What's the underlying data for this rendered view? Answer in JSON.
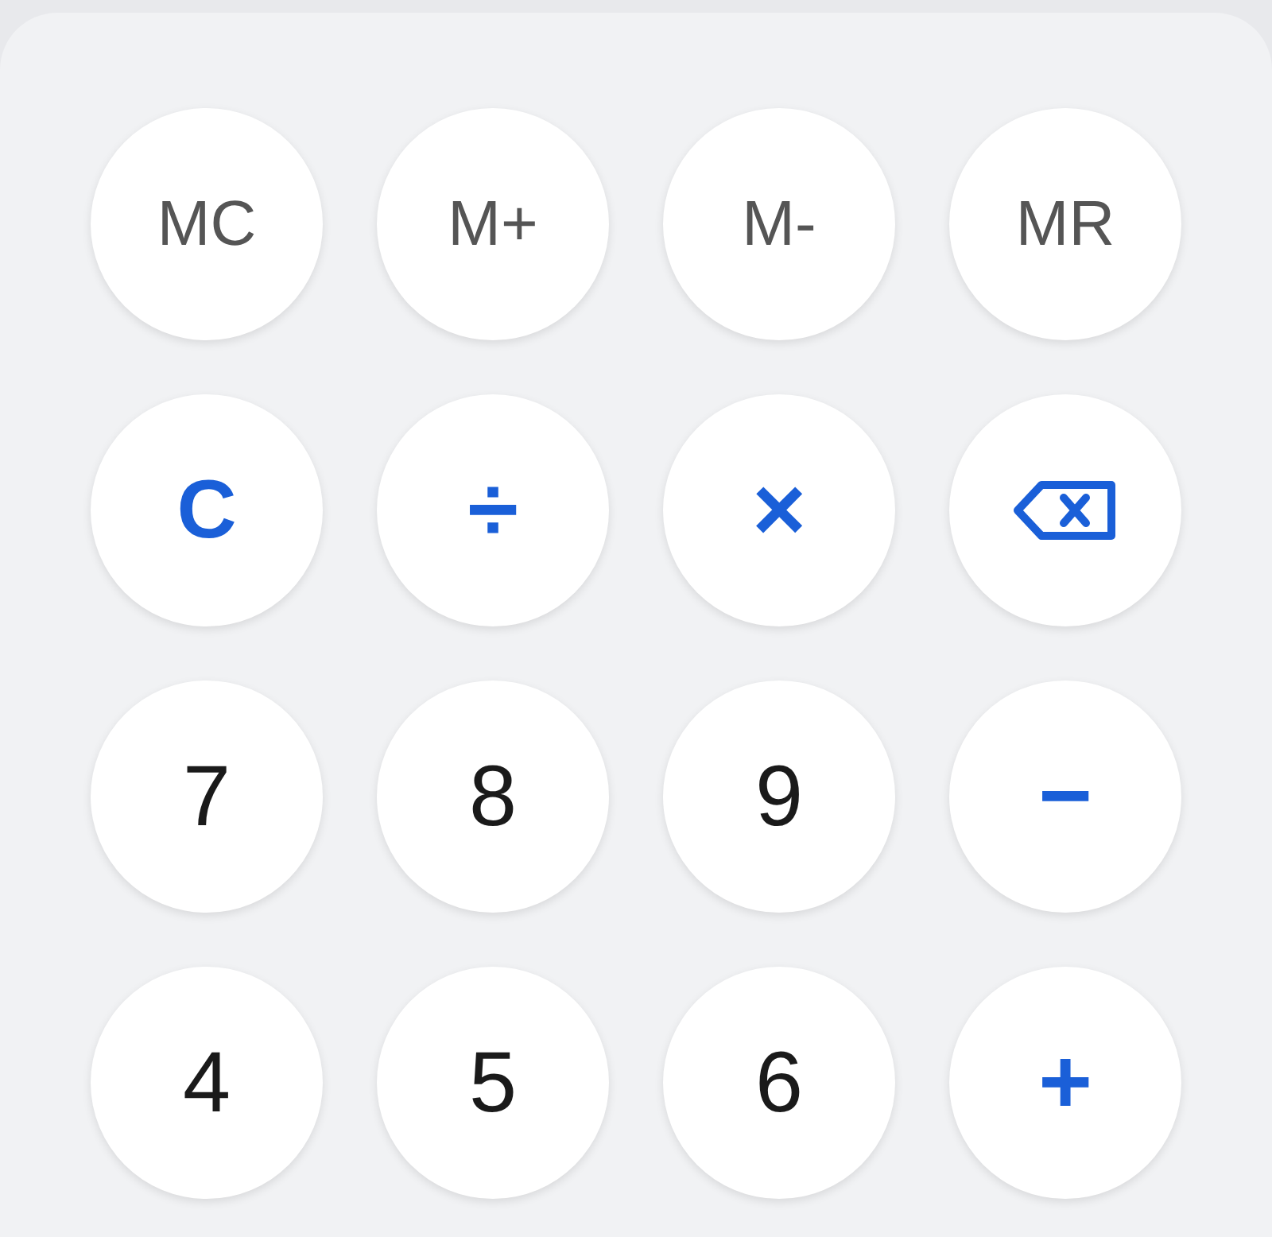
{
  "keys": [
    {
      "kind": "memory",
      "label": "MC"
    },
    {
      "kind": "memory",
      "label": "M+"
    },
    {
      "kind": "memory",
      "label": "M-"
    },
    {
      "kind": "memory",
      "label": "MR"
    },
    {
      "kind": "clear",
      "label": "C"
    },
    {
      "kind": "operator",
      "label": "÷"
    },
    {
      "kind": "operator",
      "label": "×"
    },
    {
      "kind": "backspace"
    },
    {
      "kind": "digit",
      "label": "7"
    },
    {
      "kind": "digit",
      "label": "8"
    },
    {
      "kind": "digit",
      "label": "9"
    },
    {
      "kind": "operator",
      "label": "−"
    },
    {
      "kind": "digit",
      "label": "4"
    },
    {
      "kind": "digit",
      "label": "5"
    },
    {
      "kind": "digit",
      "label": "6"
    },
    {
      "kind": "operator",
      "label": "+"
    }
  ]
}
